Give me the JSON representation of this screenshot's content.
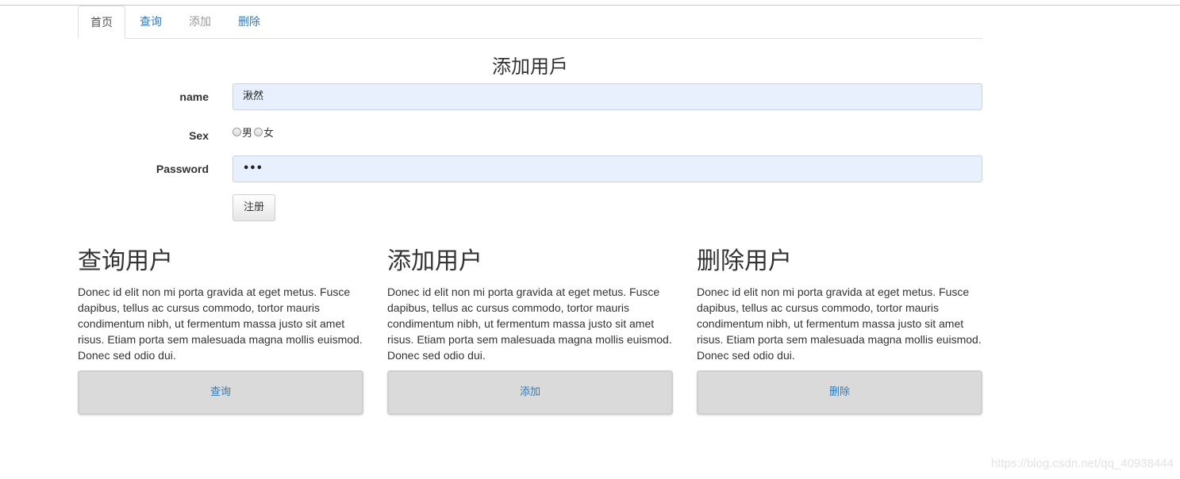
{
  "tabs": [
    {
      "label": "首页",
      "state": "active"
    },
    {
      "label": "查询",
      "state": "link"
    },
    {
      "label": "添加",
      "state": "disabled"
    },
    {
      "label": "删除",
      "state": "link"
    }
  ],
  "form": {
    "title": "添加用戶",
    "name_label": "name",
    "name_value": "湫然",
    "sex_label": "Sex",
    "sex_options": [
      "男",
      "女"
    ],
    "password_label": "Password",
    "password_value": "•••",
    "submit_label": "注册"
  },
  "columns": [
    {
      "heading": "查询用户",
      "text": "Donec id elit non mi porta gravida at eget metus. Fusce dapibus, tellus ac cursus commodo, tortor mauris condimentum nibh, ut fermentum massa justo sit amet risus. Etiam porta sem malesuada magna mollis euismod. Donec sed odio dui.",
      "button": "查询"
    },
    {
      "heading": "添加用户",
      "text": "Donec id elit non mi porta gravida at eget metus. Fusce dapibus, tellus ac cursus commodo, tortor mauris condimentum nibh, ut fermentum massa justo sit amet risus. Etiam porta sem malesuada magna mollis euismod. Donec sed odio dui.",
      "button": "添加"
    },
    {
      "heading": "删除用户",
      "text": "Donec id elit non mi porta gravida at eget metus. Fusce dapibus, tellus ac cursus commodo, tortor mauris condimentum nibh, ut fermentum massa justo sit amet risus. Etiam porta sem malesuada magna mollis euismod. Donec sed odio dui.",
      "button": "删除"
    }
  ],
  "watermark": "https://blog.csdn.net/qq_40938444",
  "colors": {
    "link": "#337ab7",
    "input_bg": "#e8f0fe",
    "button_bg": "#dadada"
  }
}
